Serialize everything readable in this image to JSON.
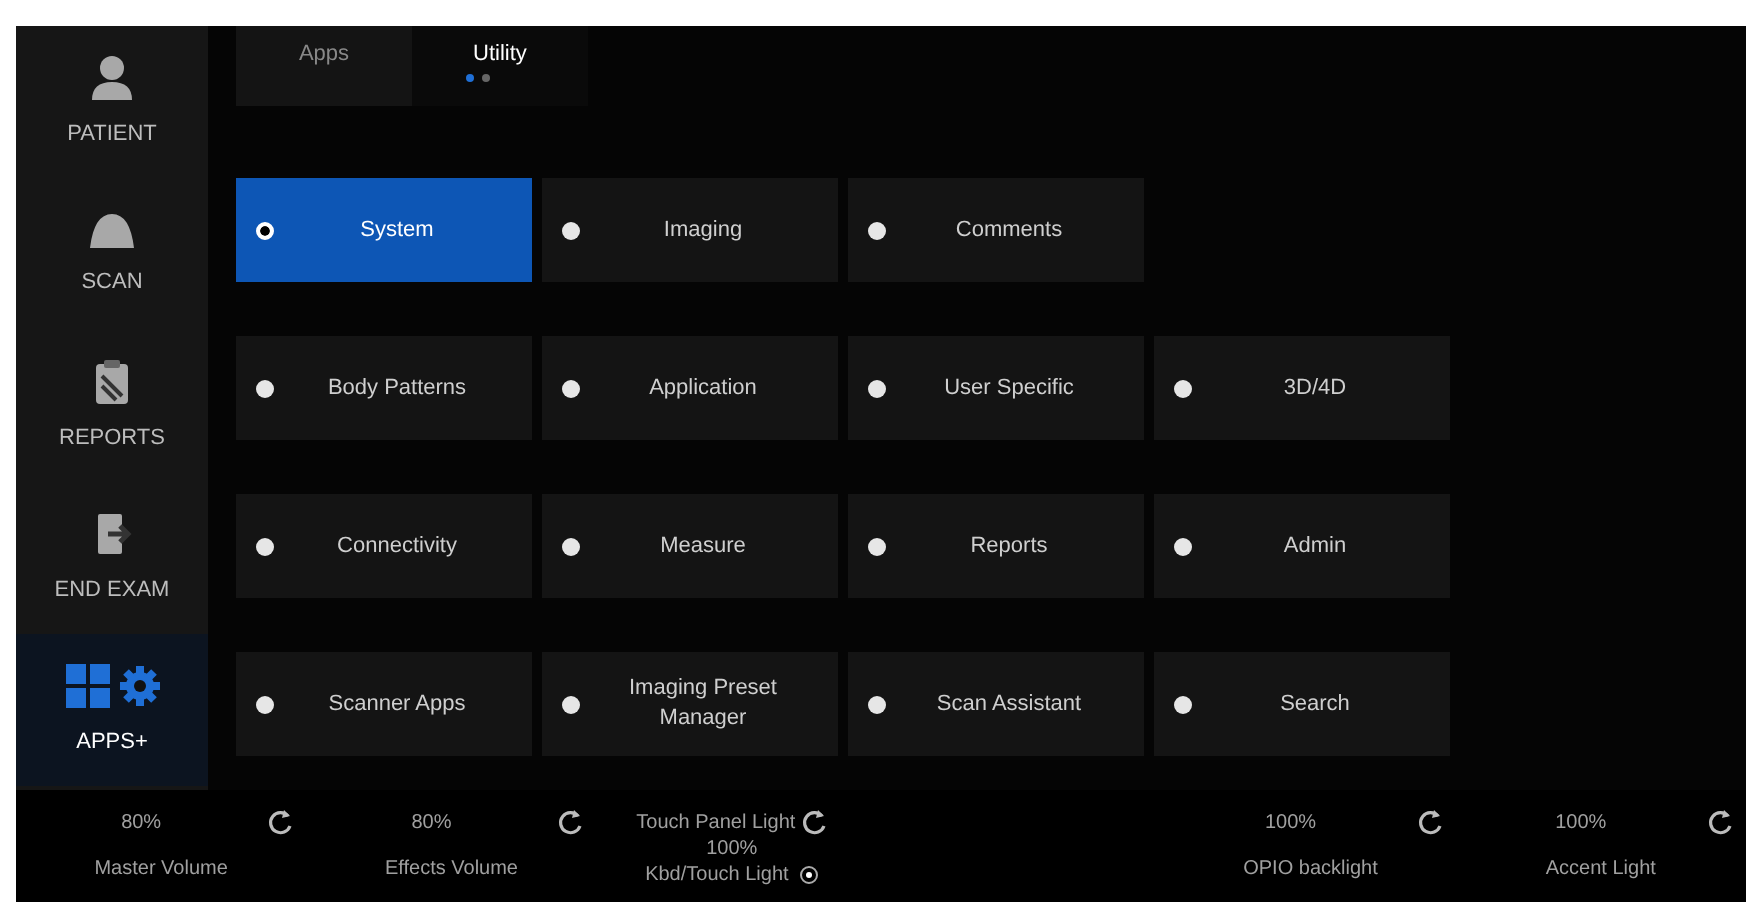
{
  "sidebar": {
    "items": [
      {
        "label": "PATIENT",
        "kind": "person",
        "selected": false
      },
      {
        "label": "SCAN",
        "kind": "probe",
        "selected": false
      },
      {
        "label": "REPORTS",
        "kind": "clipboard",
        "selected": false
      },
      {
        "label": "END EXAM",
        "kind": "exit",
        "selected": false
      },
      {
        "label": "APPS+",
        "kind": "apps",
        "selected": true
      }
    ]
  },
  "tabs": [
    {
      "label": "Apps",
      "selected": false
    },
    {
      "label": "Utility",
      "selected": true
    }
  ],
  "page_dots": [
    {
      "selected": true
    },
    {
      "selected": false
    }
  ],
  "menu_rows": [
    [
      {
        "label": "System",
        "selected": true
      },
      {
        "label": "Imaging",
        "selected": false
      },
      {
        "label": "Comments",
        "selected": false
      }
    ],
    [
      {
        "label": "Body Patterns",
        "selected": false
      },
      {
        "label": "Application",
        "selected": false
      },
      {
        "label": "User Specific",
        "selected": false
      },
      {
        "label": "3D/4D",
        "selected": false
      }
    ],
    [
      {
        "label": "Connectivity",
        "selected": false
      },
      {
        "label": "Measure",
        "selected": false
      },
      {
        "label": "Reports",
        "selected": false
      },
      {
        "label": "Admin",
        "selected": false
      }
    ],
    [
      {
        "label": "Scanner Apps",
        "selected": false
      },
      {
        "label": "Imaging Preset Manager",
        "selected": false
      },
      {
        "label": "Scan Assistant",
        "selected": false
      },
      {
        "label": "Search",
        "selected": false
      }
    ]
  ],
  "controls": [
    {
      "kind": "value",
      "value": "80%",
      "label": "Master Volume"
    },
    {
      "kind": "value",
      "value": "80%",
      "label": "Effects Volume"
    },
    {
      "kind": "light",
      "title": "Touch Panel Light",
      "value": "100%",
      "label": "Kbd/Touch Light",
      "checked": true
    },
    {
      "kind": "empty"
    },
    {
      "kind": "value",
      "value": "100%",
      "label": "OPIO backlight"
    },
    {
      "kind": "value",
      "value": "100%",
      "label": "Accent Light"
    }
  ]
}
